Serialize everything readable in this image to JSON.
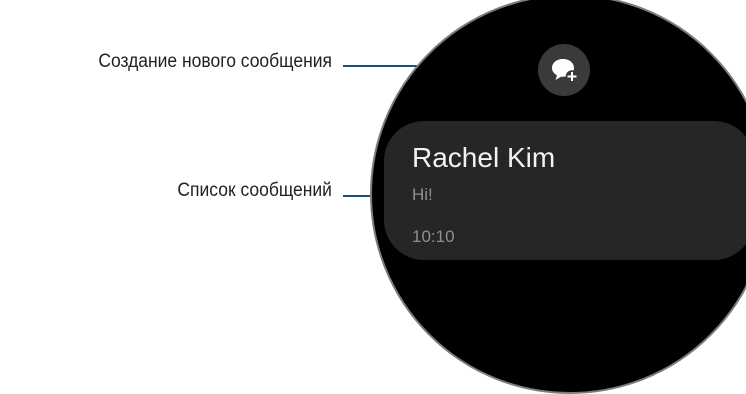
{
  "callouts": {
    "compose": "Создание нового сообщения",
    "list": "Список сообщений"
  },
  "compose_button": {
    "icon": "new-message-bubble-plus-icon"
  },
  "messages": [
    {
      "name": "Rachel Kim",
      "preview": "Hi!",
      "time": "10:10"
    }
  ],
  "colors": {
    "leader_line": "#1f4f7a",
    "watch_bg": "#000000",
    "card_bg": "#262626",
    "button_bg": "#3a3a3a"
  }
}
